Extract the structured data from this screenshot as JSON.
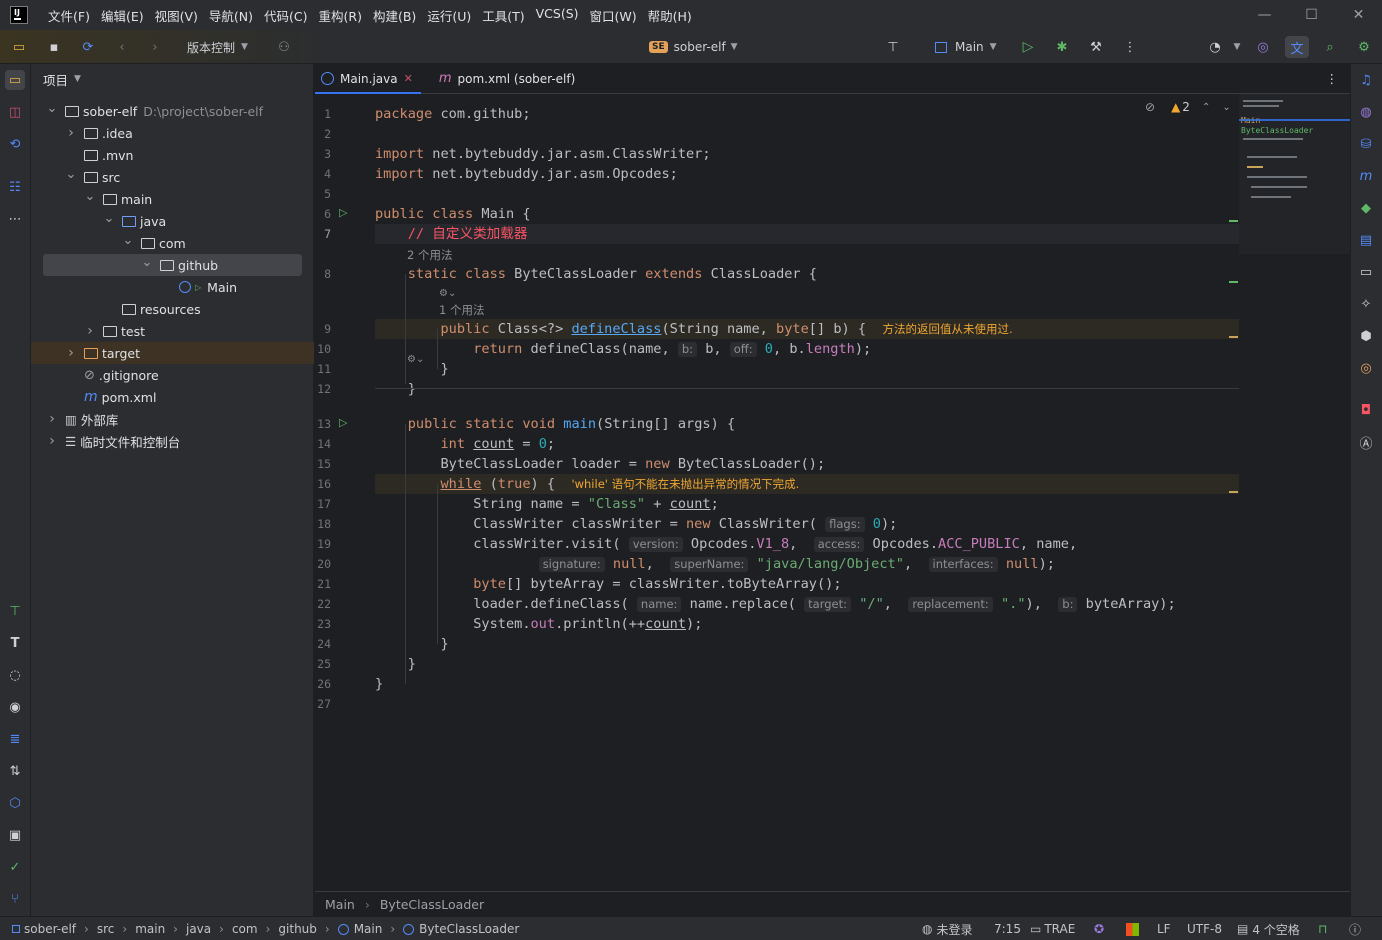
{
  "menu": [
    "文件(F)",
    "编辑(E)",
    "视图(V)",
    "导航(N)",
    "代码(C)",
    "重构(R)",
    "构建(B)",
    "运行(U)",
    "工具(T)",
    "VCS(S)",
    "窗口(W)",
    "帮助(H)"
  ],
  "toolbar": {
    "vcs_label": "版本控制",
    "project_badge": "SE",
    "project_name": "sober-elf",
    "run_config": "Main"
  },
  "project_panel": {
    "title": "项目",
    "tree": [
      {
        "label": "sober-elf",
        "extra": "D:\\project\\sober-elf",
        "depth": 0,
        "arrow": "down",
        "icon": "module-folder"
      },
      {
        "label": ".idea",
        "depth": 1,
        "arrow": "right",
        "icon": "folder"
      },
      {
        "label": ".mvn",
        "depth": 1,
        "arrow": "",
        "icon": "folder"
      },
      {
        "label": "src",
        "depth": 1,
        "arrow": "down",
        "icon": "folder"
      },
      {
        "label": "main",
        "depth": 2,
        "arrow": "down",
        "icon": "folder"
      },
      {
        "label": "java",
        "depth": 3,
        "arrow": "down",
        "icon": "source-folder"
      },
      {
        "label": "com",
        "depth": 4,
        "arrow": "down",
        "icon": "package"
      },
      {
        "label": "github",
        "depth": 5,
        "arrow": "down",
        "icon": "package",
        "selected": true
      },
      {
        "label": "Main",
        "depth": 6,
        "arrow": "",
        "icon": "java-class"
      },
      {
        "label": "resources",
        "depth": 3,
        "arrow": "",
        "icon": "resources-folder"
      },
      {
        "label": "test",
        "depth": 2,
        "arrow": "right",
        "icon": "folder"
      },
      {
        "label": "target",
        "depth": 1,
        "arrow": "right",
        "icon": "excluded-folder",
        "highlight": true
      },
      {
        "label": ".gitignore",
        "depth": 1,
        "arrow": "",
        "icon": "ignore-file"
      },
      {
        "label": "pom.xml",
        "depth": 1,
        "arrow": "",
        "icon": "maven-file"
      },
      {
        "label": "外部库",
        "depth": 0,
        "arrow": "right",
        "icon": "library"
      },
      {
        "label": "临时文件和控制台",
        "depth": 0,
        "arrow": "right",
        "icon": "scratches"
      }
    ]
  },
  "editor": {
    "tabs": [
      {
        "label": "Main.java",
        "active": true,
        "closable": true
      },
      {
        "label": "pom.xml (sober-elf)",
        "active": false
      }
    ],
    "problems_count": "2",
    "usage_hints": {
      "class": "2 个用法",
      "method": "1 个用法"
    },
    "inline_warnings": {
      "define_class": "方法的返回值从未使用过.",
      "while_loop": "'while' 语句不能在未抛出异常的情况下完成."
    },
    "param_hints": {
      "b": "b:",
      "off": "off:",
      "flags": "flags:",
      "version": "version:",
      "access": "access:",
      "signature": "signature:",
      "superName": "superName:",
      "interfaces": "interfaces:",
      "name": "name:",
      "target": "target:",
      "replacement": "replacement:",
      "b2": "b:"
    },
    "breadcrumbs": [
      "Main",
      "ByteClassLoader"
    ],
    "minimap_labels": [
      "Main",
      "ByteClassLoader"
    ]
  },
  "statusbar": {
    "path": [
      "sober-elf",
      "src",
      "main",
      "java",
      "com",
      "github",
      "Main",
      "ByteClassLoader"
    ],
    "login": "未登录",
    "position": "7:15",
    "trae": "TRAE",
    "line_sep": "LF",
    "encoding": "UTF-8",
    "indent": "4 个空格"
  }
}
